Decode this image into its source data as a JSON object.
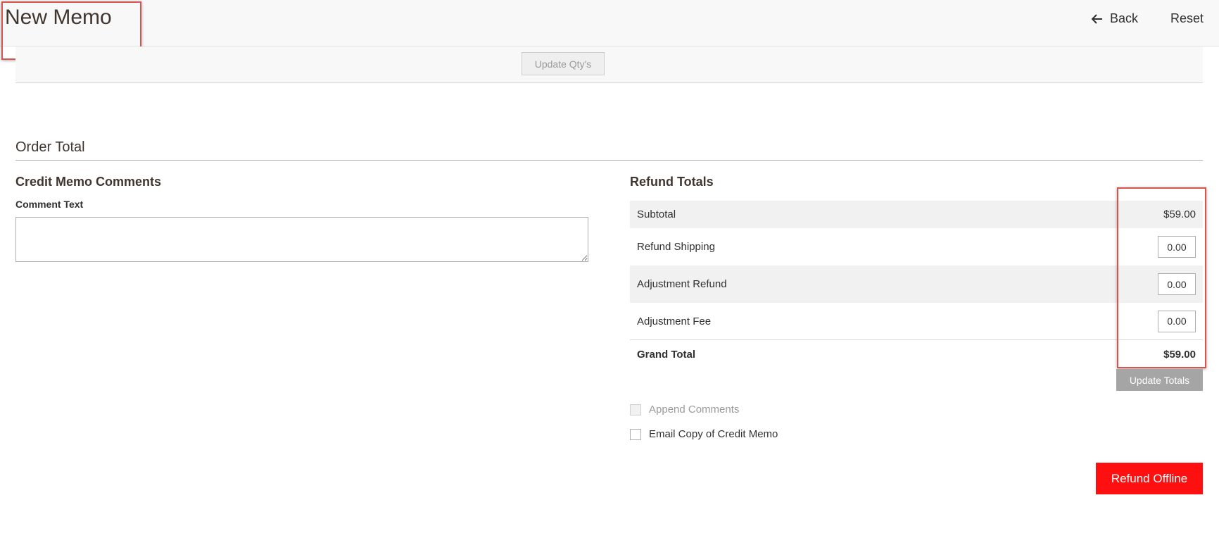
{
  "header": {
    "title": "New Memo",
    "back_label": "Back",
    "reset_label": "Reset"
  },
  "items": {
    "update_qty_label": "Update Qty's"
  },
  "order_total": {
    "section_title": "Order Total",
    "comments": {
      "heading": "Credit Memo Comments",
      "comment_label": "Comment Text",
      "comment_value": ""
    },
    "refund_totals": {
      "heading": "Refund Totals",
      "subtotal_label": "Subtotal",
      "subtotal_value": "$59.00",
      "refund_shipping_label": "Refund Shipping",
      "refund_shipping_value": "0.00",
      "adjustment_refund_label": "Adjustment Refund",
      "adjustment_refund_value": "0.00",
      "adjustment_fee_label": "Adjustment Fee",
      "adjustment_fee_value": "0.00",
      "grand_total_label": "Grand Total",
      "grand_total_value": "$59.00",
      "update_totals_label": "Update Totals"
    },
    "append_comments_label": "Append Comments",
    "append_comments_checked": false,
    "append_comments_disabled": true,
    "email_copy_label": "Email Copy of Credit Memo",
    "email_copy_checked": false,
    "refund_offline_label": "Refund Offline"
  },
  "colors": {
    "primary_action": "#ff1010",
    "highlight_box": "#d9534f"
  },
  "icons": {
    "back": "arrow-left-icon"
  }
}
